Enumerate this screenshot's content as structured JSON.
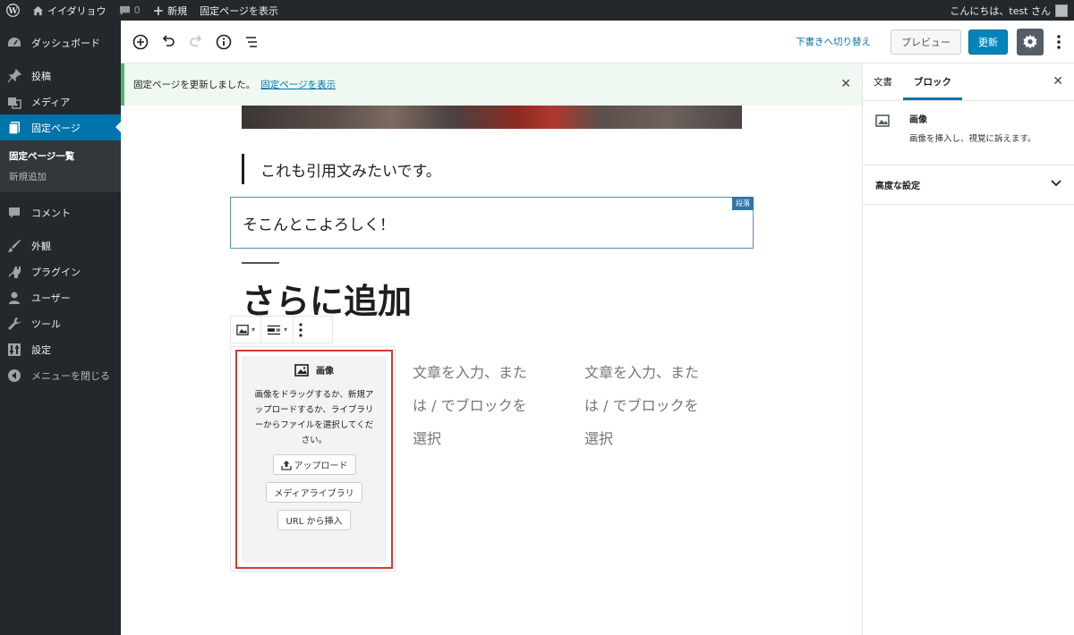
{
  "admin_bar": {
    "site_name": "イイダリョウ",
    "comments_count": "0",
    "new_label": "新規",
    "view_page_label": "固定ページを表示",
    "greeting": "こんにちは、test さん"
  },
  "sidebar": {
    "items": [
      {
        "label": "ダッシュボード",
        "icon": "dashboard-icon"
      },
      {
        "label": "投稿",
        "icon": "pin-icon"
      },
      {
        "label": "メディア",
        "icon": "media-icon"
      },
      {
        "label": "固定ページ",
        "icon": "pages-icon"
      },
      {
        "label": "コメント",
        "icon": "comment-icon"
      },
      {
        "label": "外観",
        "icon": "appearance-icon"
      },
      {
        "label": "プラグイン",
        "icon": "plugin-icon"
      },
      {
        "label": "ユーザー",
        "icon": "user-icon"
      },
      {
        "label": "ツール",
        "icon": "tools-icon"
      },
      {
        "label": "設定",
        "icon": "settings-icon"
      },
      {
        "label": "メニューを閉じる",
        "icon": "collapse-icon"
      }
    ],
    "submenu": {
      "all_pages": "固定ページ一覧",
      "add_new": "新規追加"
    }
  },
  "toolbar": {
    "switch_draft": "下書きへ切り替え",
    "preview": "プレビュー",
    "update": "更新"
  },
  "notice": {
    "message": "固定ページを更新しました。",
    "link": "固定ページを表示"
  },
  "content": {
    "quote": "これも引用文みたいです。",
    "paragraph": "そこんとこよろしく！",
    "paragraph_badge": "段落",
    "heading": "さらに追加",
    "image_block": {
      "title": "画像",
      "instructions": "画像をドラッグするか、新規アップロードするか、ライブラリーからファイルを選択してください。",
      "upload": "アップロード",
      "media_library": "メディアライブラリ",
      "insert_url": "URL から挿入"
    },
    "column_placeholder_1": "文章を入力、または / でブロックを選択",
    "column_placeholder_2": "文章を入力、または / でブロックを選択"
  },
  "settings": {
    "tab_document": "文書",
    "tab_block": "ブロック",
    "block_name": "画像",
    "block_description": "画像を挿入し、視覚に訴えます。",
    "advanced": "高度な設定"
  }
}
